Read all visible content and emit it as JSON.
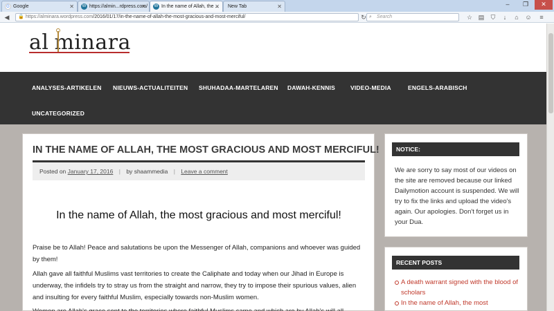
{
  "browser": {
    "tabs": [
      {
        "title": "Google",
        "favicon": "google-icon",
        "color": "#4285f4"
      },
      {
        "title": "https://almin...rdpress.com/",
        "favicon": "wordpress-icon",
        "color": "#21759b"
      },
      {
        "title": "In the name of Allah, the ...",
        "favicon": "wordpress-icon",
        "color": "#21759b"
      },
      {
        "title": "New Tab",
        "favicon": "",
        "color": ""
      }
    ],
    "url_host": "https://alminara.wordpress.com",
    "url_path": "/2016/01/17/in-the-name-of-allah-the-most-gracious-and-most-merciful/",
    "search_placeholder": "Search"
  },
  "site": {
    "logo_left": "al",
    "logo_right": "minara",
    "accent_color": "#b72d2d"
  },
  "nav": {
    "items": [
      "ANALYSES-ARTIKELEN",
      "NIEUWS-ACTUALITEITEN",
      "SHUHADAA-MARTELAREN",
      "DAWAH-KENNIS",
      "VIDEO-MEDIA",
      "ENGELS-ARABISCH",
      "UNCATEGORIZED"
    ]
  },
  "post": {
    "title": "IN THE NAME OF ALLAH, THE MOST GRACIOUS AND MOST MERCIFUL!",
    "posted_on_label": "Posted on",
    "date": "January 17, 2016",
    "by_label": "by",
    "author": "shaammedia",
    "comment_link": "Leave a comment",
    "heading": "In the name of Allah, the most gracious and most merciful!",
    "paragraphs": [
      "Praise be to Allah! Peace and salutations be upon the Messenger of Allah, companions and whoever was guided by them!",
      "Allah gave all faithful Muslims vast territories to create the Caliphate and today when our Jihad in Europe is underway, the infidels try to stray us from the straight and narrow, they try to impose their spurious values, alien and insulting for every faithful Muslim, especially towards non-Muslim women.",
      "Women are Allah's grace sent to the territories where faithful Muslims came and which are by Allah's will all"
    ]
  },
  "sidebar": {
    "notice": {
      "title": "NOTICE:",
      "text": "We are sorry to say most of our videos on the site are removed because our linked Dailymotion account is suspended. We will try to fix the links and upload the video's again. Our apologies. Don't forget us in your Dua."
    },
    "recent": {
      "title": "RECENT POSTS",
      "items": [
        "A death warrant signed with the blood of scholars",
        "In the name of Allah, the most"
      ]
    }
  }
}
